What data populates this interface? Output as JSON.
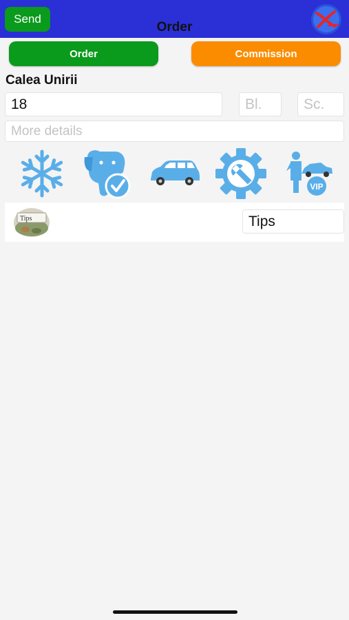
{
  "header": {
    "send_label": "Send",
    "title": "Order",
    "logo_icon": "x-logo-icon",
    "bar_color": "#2b2fd6"
  },
  "tabs": [
    {
      "label": "Order",
      "color": "#0a9a1c"
    },
    {
      "label": "Commission",
      "color": "#fb8c00"
    }
  ],
  "address": {
    "street": "Calea Unirii",
    "number_value": "18",
    "bl_placeholder": "Bl.",
    "sc_placeholder": "Sc.",
    "details_placeholder": "More details"
  },
  "options": [
    {
      "icon": "snowflake-icon"
    },
    {
      "icon": "pet-friendly-icon"
    },
    {
      "icon": "car-icon"
    },
    {
      "icon": "settings-wrench-icon"
    },
    {
      "icon": "vip-chauffeur-icon"
    }
  ],
  "options_color": "#5aaee8",
  "tips": {
    "image": "tips-jar-image",
    "jar_label": "Tips",
    "placeholder": "Tips"
  }
}
